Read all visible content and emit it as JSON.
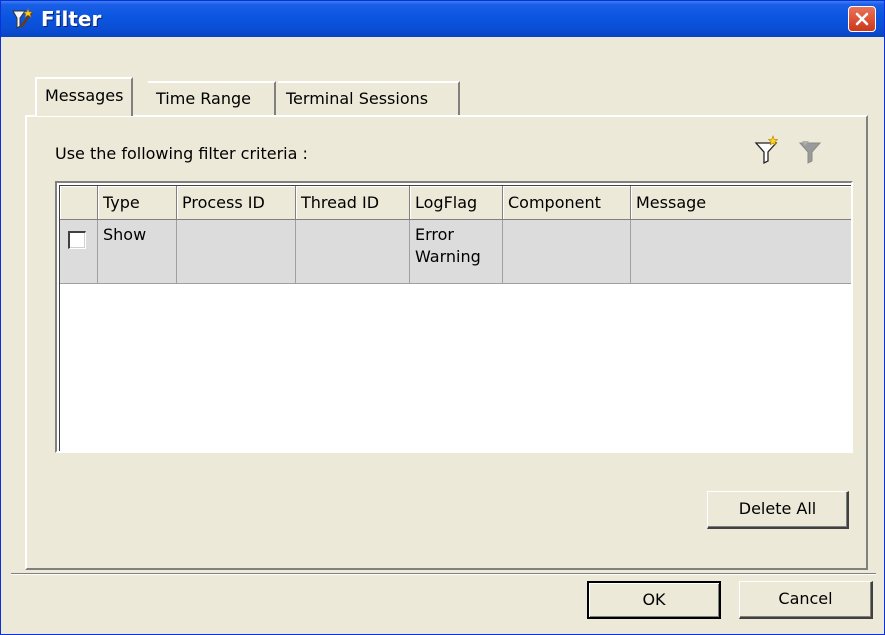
{
  "window": {
    "title": "Filter",
    "icon": "filter-wand-icon"
  },
  "tabs": [
    {
      "label": "Messages",
      "selected": true
    },
    {
      "label": "Time Range",
      "selected": false
    },
    {
      "label": "Terminal Sessions",
      "selected": false
    }
  ],
  "panel": {
    "criteria_label": "Use the following filter criteria :",
    "toolbar_icons": [
      "new-filter-icon",
      "remove-filter-icon"
    ]
  },
  "grid": {
    "columns": [
      "",
      "Type",
      "Process ID",
      "Thread ID",
      "LogFlag",
      "Component",
      "Message"
    ],
    "rows": [
      {
        "checked": false,
        "type": "Show",
        "process_id": "",
        "thread_id": "",
        "logflag_line1": "Error",
        "logflag_line2": "Warning",
        "component": "",
        "message": ""
      }
    ]
  },
  "buttons": {
    "delete_all": "Delete All",
    "ok": "OK",
    "cancel": "Cancel"
  }
}
